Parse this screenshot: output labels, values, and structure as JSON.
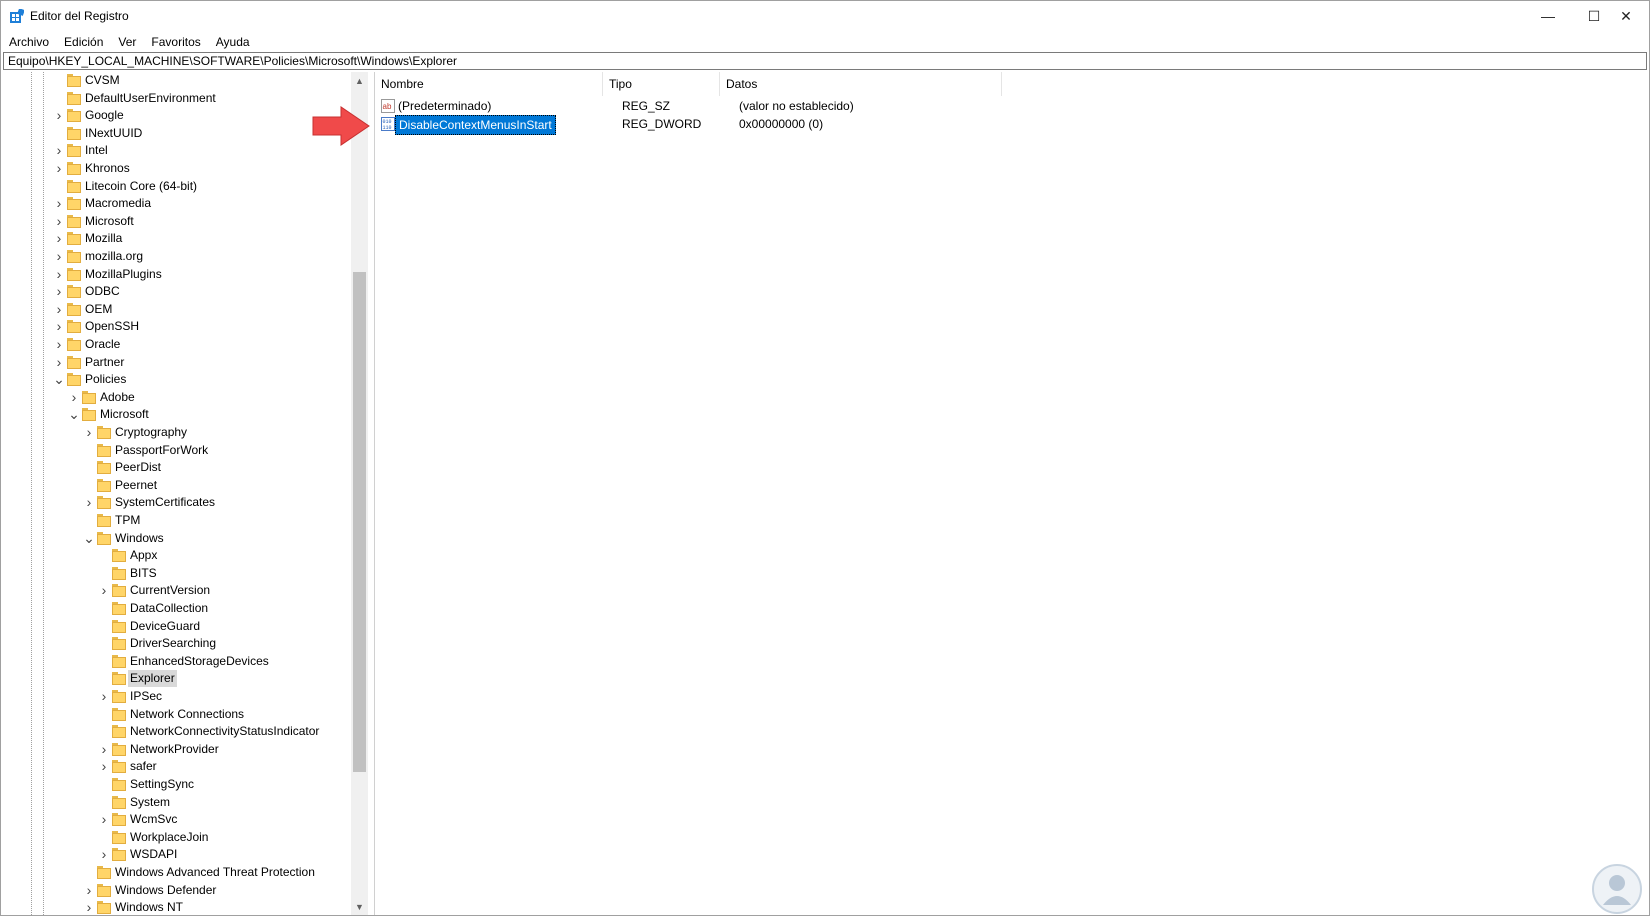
{
  "window": {
    "title": "Editor del Registro",
    "controls": {
      "minimize": "—",
      "maximize": "☐",
      "close": "✕"
    }
  },
  "menubar": [
    "Archivo",
    "Edición",
    "Ver",
    "Favoritos",
    "Ayuda"
  ],
  "address": "Equipo\\HKEY_LOCAL_MACHINE\\SOFTWARE\\Policies\\Microsoft\\Windows\\Explorer",
  "tree": [
    {
      "label": "CVSM",
      "level": 0,
      "expander": "none"
    },
    {
      "label": "DefaultUserEnvironment",
      "level": 0,
      "expander": "none"
    },
    {
      "label": "Google",
      "level": 0,
      "expander": "collapsed"
    },
    {
      "label": "INextUUID",
      "level": 0,
      "expander": "none"
    },
    {
      "label": "Intel",
      "level": 0,
      "expander": "collapsed"
    },
    {
      "label": "Khronos",
      "level": 0,
      "expander": "collapsed"
    },
    {
      "label": "Litecoin Core (64-bit)",
      "level": 0,
      "expander": "none"
    },
    {
      "label": "Macromedia",
      "level": 0,
      "expander": "collapsed"
    },
    {
      "label": "Microsoft",
      "level": 0,
      "expander": "collapsed"
    },
    {
      "label": "Mozilla",
      "level": 0,
      "expander": "collapsed"
    },
    {
      "label": "mozilla.org",
      "level": 0,
      "expander": "collapsed"
    },
    {
      "label": "MozillaPlugins",
      "level": 0,
      "expander": "collapsed"
    },
    {
      "label": "ODBC",
      "level": 0,
      "expander": "collapsed"
    },
    {
      "label": "OEM",
      "level": 0,
      "expander": "collapsed"
    },
    {
      "label": "OpenSSH",
      "level": 0,
      "expander": "collapsed"
    },
    {
      "label": "Oracle",
      "level": 0,
      "expander": "collapsed"
    },
    {
      "label": "Partner",
      "level": 0,
      "expander": "collapsed"
    },
    {
      "label": "Policies",
      "level": 0,
      "expander": "expanded"
    },
    {
      "label": "Adobe",
      "level": 1,
      "expander": "collapsed"
    },
    {
      "label": "Microsoft",
      "level": 1,
      "expander": "expanded"
    },
    {
      "label": "Cryptography",
      "level": 2,
      "expander": "collapsed"
    },
    {
      "label": "PassportForWork",
      "level": 2,
      "expander": "none"
    },
    {
      "label": "PeerDist",
      "level": 2,
      "expander": "none"
    },
    {
      "label": "Peernet",
      "level": 2,
      "expander": "none"
    },
    {
      "label": "SystemCertificates",
      "level": 2,
      "expander": "collapsed"
    },
    {
      "label": "TPM",
      "level": 2,
      "expander": "none"
    },
    {
      "label": "Windows",
      "level": 2,
      "expander": "expanded"
    },
    {
      "label": "Appx",
      "level": 3,
      "expander": "none"
    },
    {
      "label": "BITS",
      "level": 3,
      "expander": "none"
    },
    {
      "label": "CurrentVersion",
      "level": 3,
      "expander": "collapsed"
    },
    {
      "label": "DataCollection",
      "level": 3,
      "expander": "none"
    },
    {
      "label": "DeviceGuard",
      "level": 3,
      "expander": "none"
    },
    {
      "label": "DriverSearching",
      "level": 3,
      "expander": "none"
    },
    {
      "label": "EnhancedStorageDevices",
      "level": 3,
      "expander": "none"
    },
    {
      "label": "Explorer",
      "level": 3,
      "expander": "none",
      "selected": true
    },
    {
      "label": "IPSec",
      "level": 3,
      "expander": "collapsed"
    },
    {
      "label": "Network Connections",
      "level": 3,
      "expander": "none"
    },
    {
      "label": "NetworkConnectivityStatusIndicator",
      "level": 3,
      "expander": "none"
    },
    {
      "label": "NetworkProvider",
      "level": 3,
      "expander": "collapsed"
    },
    {
      "label": "safer",
      "level": 3,
      "expander": "collapsed"
    },
    {
      "label": "SettingSync",
      "level": 3,
      "expander": "none"
    },
    {
      "label": "System",
      "level": 3,
      "expander": "none"
    },
    {
      "label": "WcmSvc",
      "level": 3,
      "expander": "collapsed"
    },
    {
      "label": "WorkplaceJoin",
      "level": 3,
      "expander": "none"
    },
    {
      "label": "WSDAPI",
      "level": 3,
      "expander": "collapsed"
    },
    {
      "label": "Windows Advanced Threat Protection",
      "level": 2,
      "expander": "none"
    },
    {
      "label": "Windows Defender",
      "level": 2,
      "expander": "collapsed"
    },
    {
      "label": "Windows NT",
      "level": 2,
      "expander": "collapsed"
    }
  ],
  "list": {
    "columns": [
      "Nombre",
      "Tipo",
      "Datos"
    ],
    "rows": [
      {
        "name": "(Predeterminado)",
        "type": "REG_SZ",
        "data": "(valor no establecido)",
        "icon": "string-value-icon",
        "selected": false
      },
      {
        "name": "DisableContextMenusInStart",
        "type": "REG_DWORD",
        "data": "0x00000000 (0)",
        "icon": "binary-value-icon",
        "selected": true
      }
    ]
  },
  "colors": {
    "selection": "#0078d7",
    "annotation_arrow": "#f04a4a",
    "folder": "#ffd568"
  }
}
